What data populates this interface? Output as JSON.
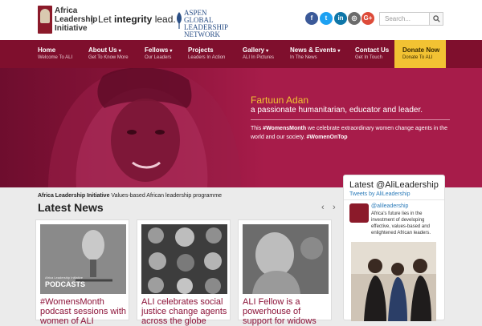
{
  "header": {
    "logo_text": "Africa Leadership Initiative",
    "tagline_prefix": "Let ",
    "tagline_bold": "integrity",
    "tagline_suffix": " lead.",
    "divider": "|",
    "partner_logo_text": "ASPEN GLOBAL LEADERSHIP NETWORK",
    "social": [
      {
        "name": "facebook",
        "glyph": "f",
        "color": "#3b5998"
      },
      {
        "name": "twitter",
        "glyph": "t",
        "color": "#1da1f2"
      },
      {
        "name": "linkedin",
        "glyph": "in",
        "color": "#0e76a8"
      },
      {
        "name": "instagram",
        "glyph": "◎",
        "color": "#6b6b6b"
      },
      {
        "name": "google-plus",
        "glyph": "G+",
        "color": "#dd4b39"
      }
    ],
    "search_placeholder": "Search..."
  },
  "nav": {
    "items": [
      {
        "label": "Home",
        "sub": "Welcome To ALI",
        "chevron": false
      },
      {
        "label": "About Us",
        "sub": "Get To Know More",
        "chevron": true
      },
      {
        "label": "Fellows",
        "sub": "Our Leaders",
        "chevron": true
      },
      {
        "label": "Projects",
        "sub": "Leaders In Action",
        "chevron": false
      },
      {
        "label": "Gallery",
        "sub": "ALI In Pictures",
        "chevron": true
      },
      {
        "label": "News & Events",
        "sub": "In The News",
        "chevron": true
      },
      {
        "label": "Contact Us",
        "sub": "Get In Touch",
        "chevron": false
      }
    ],
    "donate": {
      "label": "Donate Now",
      "sub": "Donate To ALI"
    }
  },
  "hero": {
    "name": "Fartuun Adan",
    "role": "a passionate humanitarian, educator and leader.",
    "caption_pre": "This ",
    "caption_tag1": "#WomensMonth",
    "caption_mid": " we celebrate extraordinary women change agents in the world and our society. ",
    "caption_tag2": "#WomenOnTop"
  },
  "intro": {
    "org": "Africa Leadership Initiative",
    "desc": " Values-based African leadership programme"
  },
  "news": {
    "heading": "Latest News",
    "prev_arrow": "‹",
    "next_arrow": "›",
    "cards": [
      {
        "title": "#WomensMonth podcast sessions with women of ALI",
        "img_label": "PODCASTS",
        "img_small": "Africa Leadership Initiative"
      },
      {
        "title": "ALI celebrates social justice change agents across the globe"
      },
      {
        "title": "ALI Fellow is a powerhouse of support for widows"
      }
    ]
  },
  "twitter": {
    "title": "Latest @AliLeadership",
    "by": "Tweets by AliLeadership",
    "handle": "@alileadership",
    "text": "Africa's future lies in the investment of developing effective, values-based and enlightened African leaders."
  }
}
